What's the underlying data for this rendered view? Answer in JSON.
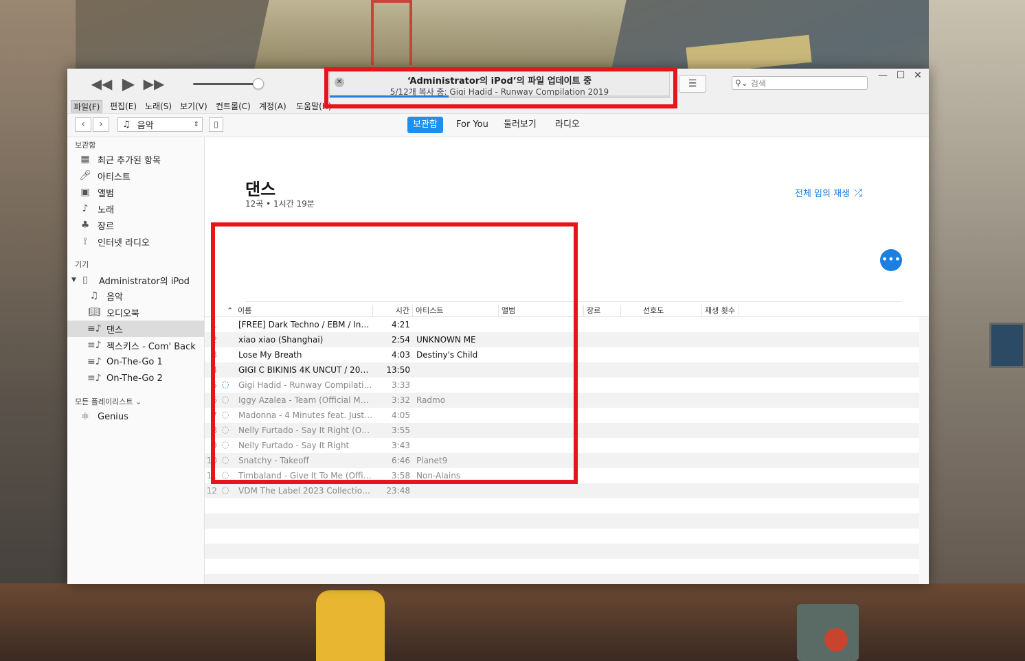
{
  "window": {
    "lcd": {
      "title": "‘Administrator의 iPod’의 파일 업데이트 중",
      "subtitle": "5/12개 복사 중: Gigi Hadid - Runway Compilation 2019",
      "progress": 0.35
    },
    "search": {
      "placeholder": "검색"
    }
  },
  "menu": [
    "파일(F)",
    "편집(E)",
    "노래(S)",
    "보기(V)",
    "컨트롤(C)",
    "계정(A)",
    "도움말(H)"
  ],
  "nav": {
    "media": "음악",
    "tabs": [
      "보관함",
      "For You",
      "둘러보기",
      "라디오"
    ]
  },
  "sidebar": {
    "library_header": "보관함",
    "library": [
      "최근 추가된 항목",
      "아티스트",
      "앨범",
      "노래",
      "장르",
      "인터넷 라디오"
    ],
    "devices_header": "기기",
    "device_name": "Administrator의 iPod",
    "device_items": [
      "음악",
      "오디오북",
      "댄스",
      "젝스키스 - Com' Back",
      "On-The-Go 1",
      "On-The-Go 2"
    ],
    "playlists_header": "모든 플레이리스트",
    "playlists": [
      "Genius"
    ]
  },
  "playlist": {
    "title": "댄스",
    "meta": "12곡 • 1시간 19분",
    "shuffle_label": "전체 임의 재생"
  },
  "columns": [
    "이름",
    "시간",
    "아티스트",
    "앨범",
    "장르",
    "선호도",
    "재생 횟수"
  ],
  "tracks": [
    {
      "num": "1",
      "name": "[FREE] Dark Techno / EBM / Indust...",
      "time": "4:21",
      "artist": ""
    },
    {
      "num": "2",
      "name": "xiao xiao (Shanghai)",
      "time": "2:54",
      "artist": "UNKNOWN ME"
    },
    {
      "num": "3",
      "name": "Lose My Breath",
      "time": "4:03",
      "artist": "Destiny's Child"
    },
    {
      "num": "4",
      "name": "GIGI C BIKINIS 4K UNCUT / 2019 S...",
      "time": "13:50",
      "artist": ""
    },
    {
      "num": "5",
      "name": "Gigi Hadid - Runway Compilation...",
      "time": "3:33",
      "artist": ""
    },
    {
      "num": "6",
      "name": "Iggy Azalea - Team (Official Music...",
      "time": "3:32",
      "artist": "Radmo"
    },
    {
      "num": "7",
      "name": "Madonna - 4 Minutes feat. Justin...",
      "time": "4:05",
      "artist": ""
    },
    {
      "num": "8",
      "name": "Nelly Furtado - Say It Right (Offici...",
      "time": "3:55",
      "artist": ""
    },
    {
      "num": "9",
      "name": "Nelly Furtado - Say It Right",
      "time": "3:43",
      "artist": ""
    },
    {
      "num": "10",
      "name": "Snatchy - Takeoff",
      "time": "6:46",
      "artist": "Planet9"
    },
    {
      "num": "11",
      "name": "Timbaland - Give It To Me (Official...",
      "time": "3:58",
      "artist": "Non-Alains"
    },
    {
      "num": "12",
      "name": "VDM The Label 2023 Collection in...",
      "time": "23:48",
      "artist": ""
    }
  ],
  "colors": {
    "accent": "#1d8ff0",
    "highlight": "#e8141b"
  }
}
